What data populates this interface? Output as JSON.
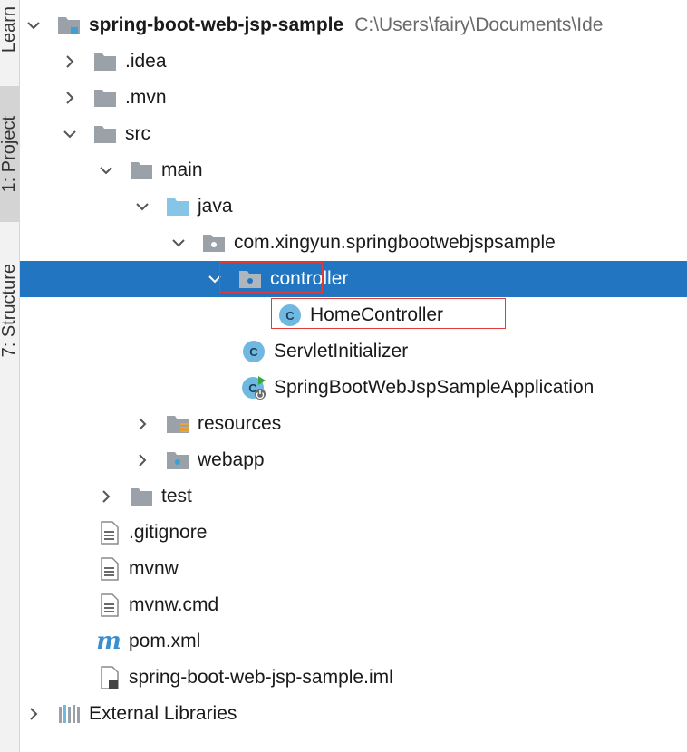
{
  "sidebar": {
    "tabs": [
      {
        "label": "Learn"
      },
      {
        "label": "1: Project"
      },
      {
        "label": "7: Structure"
      }
    ]
  },
  "tree": {
    "root": {
      "label": "spring-boot-web-jsp-sample",
      "path": "C:\\Users\\fairy\\Documents\\Ide"
    },
    "items": [
      {
        "label": ".idea"
      },
      {
        "label": ".mvn"
      },
      {
        "label": "src"
      },
      {
        "label": "main"
      },
      {
        "label": "java"
      },
      {
        "label": "com.xingyun.springbootwebjspsample"
      },
      {
        "label": "controller"
      },
      {
        "label": "HomeController"
      },
      {
        "label": "ServletInitializer"
      },
      {
        "label": "SpringBootWebJspSampleApplication"
      },
      {
        "label": "resources"
      },
      {
        "label": "webapp"
      },
      {
        "label": "test"
      },
      {
        "label": ".gitignore"
      },
      {
        "label": "mvnw"
      },
      {
        "label": "mvnw.cmd"
      },
      {
        "label": "pom.xml"
      },
      {
        "label": "spring-boot-web-jsp-sample.iml"
      },
      {
        "label": "External Libraries"
      }
    ]
  },
  "colors": {
    "selection": "#2275c0",
    "highlight_box": "#e23b3b",
    "folder": "#9aa1a8",
    "source_folder": "#87c5e6",
    "class_circle": "#6fb8e0"
  }
}
